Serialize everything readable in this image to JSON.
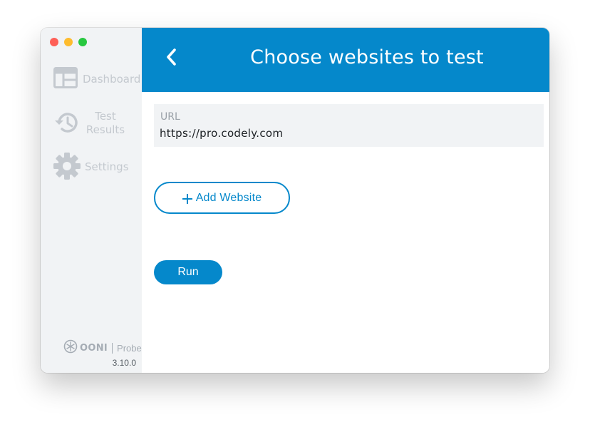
{
  "window": {
    "controls": [
      "close",
      "minimize",
      "zoom"
    ]
  },
  "sidebar": {
    "items": [
      {
        "label": "Dashboard",
        "icon": "dashboard-icon"
      },
      {
        "label": "Test\nResults",
        "icon": "history-icon"
      },
      {
        "label": "Settings",
        "icon": "gear-icon"
      }
    ],
    "brand": {
      "name": "OONI",
      "product": "Probe",
      "logo_icon": "ooni-logo-icon"
    },
    "version": "3.10.0"
  },
  "header": {
    "title": "Choose websites to test",
    "back_icon": "chevron-left-icon"
  },
  "form": {
    "url_label": "URL",
    "url_value": "https://pro.codely.com",
    "add_website_label": "Add Website",
    "add_icon": "plus-icon",
    "run_label": "Run"
  },
  "colors": {
    "accent": "#0588cb",
    "sidebar_bg": "#f1f3f5",
    "sidebar_text": "#c4c9cf",
    "field_bg": "#f1f3f5"
  }
}
